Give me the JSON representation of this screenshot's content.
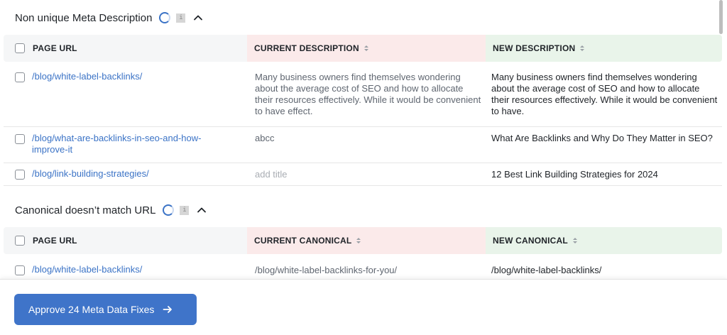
{
  "sections": [
    {
      "title": "Non unique Meta Description",
      "columns": {
        "url": "PAGE URL",
        "current": "CURRENT DESCRIPTION",
        "new": "NEW DESCRIPTION"
      },
      "rows": [
        {
          "url": "/blog/white-label-backlinks/",
          "current": "Many business owners find themselves wondering about the average cost of SEO and how to allocate their resources effectively. While it would be convenient to have effect.",
          "new": "Many business owners find themselves wondering about the average cost of SEO and how to allocate their resources effectively. While it would be convenient to have."
        },
        {
          "url": "/blog/what-are-backlinks-in-seo-and-how-improve-it",
          "current": "abcc",
          "new": "What Are Backlinks and Why Do They Matter in SEO?"
        },
        {
          "url": "/blog/link-building-strategies/",
          "current": "add title",
          "new": "12 Best Link Building Strategies for 2024"
        }
      ]
    },
    {
      "title": "Canonical doesn’t match URL",
      "columns": {
        "url": "PAGE URL",
        "current": "CURRENT CANONICAL",
        "new": "NEW CANONICAL"
      },
      "rows": [
        {
          "url": "/blog/white-label-backlinks/",
          "current": "/blog/white-label-backlinks-for-you/",
          "new": "/blog/white-label-backlinks/"
        }
      ]
    }
  ],
  "icons": {
    "spinner": "loading-spinner-icon",
    "info": "info-icon",
    "collapse": "chevron-up-icon",
    "sort": "sort-icon",
    "arrow": "arrow-right-icon"
  },
  "footer": {
    "approve_label": "Approve 24 Meta Data Fixes"
  },
  "colors": {
    "accent": "#3f74c9",
    "link": "#3b73c6",
    "current_header_bg": "#fbeaea",
    "new_header_bg": "#e9f4ea",
    "url_header_bg": "#f5f6f7"
  }
}
